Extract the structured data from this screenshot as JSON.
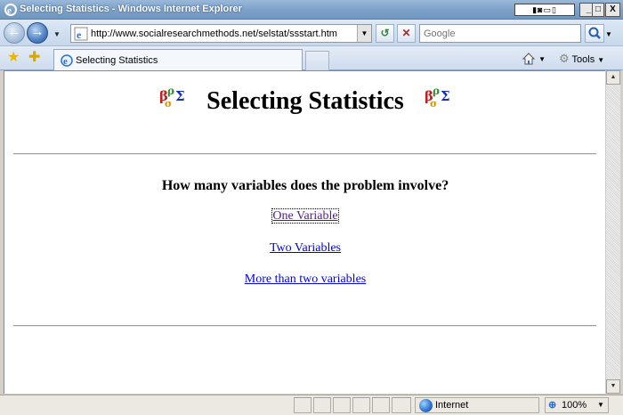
{
  "window": {
    "title": "Selecting Statistics - Windows Internet Explorer",
    "controls": {
      "minimize": "_",
      "maximize": "□",
      "close": "X"
    }
  },
  "navbar": {
    "url": "http://www.socialresearchmethods.net/selstat/ssstart.htm",
    "search_placeholder": "Google"
  },
  "tabbar": {
    "tab_label": "Selecting Statistics",
    "tools_label": "Tools"
  },
  "page": {
    "title": "Selecting Statistics",
    "question": "How many variables does the problem involve?",
    "links": [
      {
        "label": "One Variable",
        "visited": true
      },
      {
        "label": "Two Variables",
        "visited": false
      },
      {
        "label": "More than two variables",
        "visited": false
      }
    ]
  },
  "statusbar": {
    "zone": "Internet",
    "zoom": "100%"
  },
  "colors": {
    "link": "#0000ee",
    "visited_link": "#551a8b",
    "titlebar": "#7ea2c9"
  }
}
